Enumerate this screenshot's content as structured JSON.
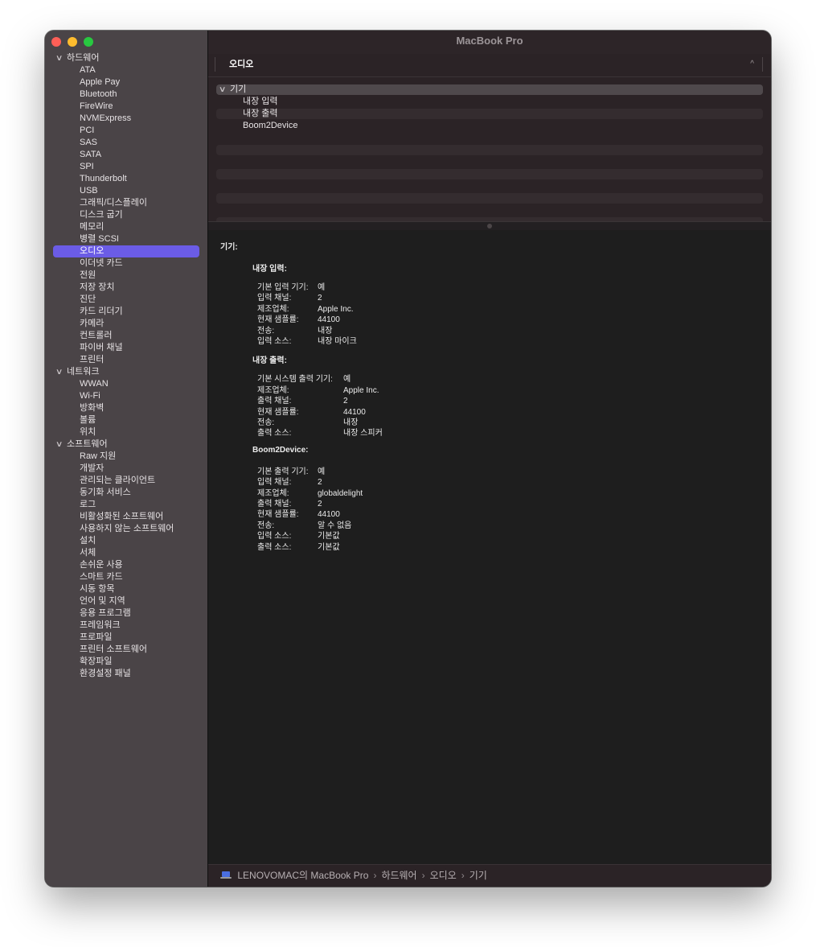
{
  "window": {
    "title": "MacBook Pro"
  },
  "sidebar": {
    "groups": [
      {
        "label": "하드웨어",
        "items": [
          "ATA",
          "Apple Pay",
          "Bluetooth",
          "FireWire",
          "NVMExpress",
          "PCI",
          "SAS",
          "SATA",
          "SPI",
          "Thunderbolt",
          "USB",
          "그래픽/디스플레이",
          "디스크 굽기",
          "메모리",
          "병렬 SCSI",
          "오디오",
          "이더넷 카드",
          "전원",
          "저장 장치",
          "진단",
          "카드 리더기",
          "카메라",
          "컨트롤러",
          "파이버 채널",
          "프린터"
        ]
      },
      {
        "label": "네트워크",
        "items": [
          "WWAN",
          "Wi-Fi",
          "방화벽",
          "볼륨",
          "위치"
        ]
      },
      {
        "label": "소프트웨어",
        "items": [
          "Raw 지원",
          "개발자",
          "관리되는 클라이언트",
          "동기화 서비스",
          "로그",
          "비활성화된 소프트웨어",
          "사용하지 않는 소프트웨어",
          "설치",
          "서체",
          "손쉬운 사용",
          "스마트 카드",
          "시동 항목",
          "언어 및 지역",
          "응용 프로그램",
          "프레임워크",
          "프로파일",
          "프린터 소프트웨어",
          "확장파일",
          "환경설정 패널"
        ]
      }
    ],
    "selected": "오디오"
  },
  "list": {
    "column_header": "오디오",
    "parent": "기기",
    "children": [
      "내장 입력",
      "내장 출력",
      "Boom2Device"
    ]
  },
  "detail": {
    "title": "기기:",
    "devices": [
      {
        "name": "내장 입력:",
        "props": [
          {
            "k": "기본 입력 기기:",
            "v": "예"
          },
          {
            "k": "입력 채널:",
            "v": "2"
          },
          {
            "k": "제조업체:",
            "v": "Apple Inc."
          },
          {
            "k": "현재 샘플률:",
            "v": "44100"
          },
          {
            "k": "전송:",
            "v": "내장"
          },
          {
            "k": "입력 소스:",
            "v": "내장 마이크"
          }
        ]
      },
      {
        "name": "내장 출력:",
        "props": [
          {
            "k": "기본 시스템 출력 기기:",
            "v": "예"
          },
          {
            "k": "제조업체:",
            "v": "Apple Inc."
          },
          {
            "k": "출력 채널:",
            "v": "2"
          },
          {
            "k": "현재 샘플률:",
            "v": "44100"
          },
          {
            "k": "전송:",
            "v": "내장"
          },
          {
            "k": "출력 소스:",
            "v": "내장 스피커"
          }
        ]
      },
      {
        "name": "Boom2Device:",
        "props": [
          {
            "k": "기본 출력 기기:",
            "v": "예"
          },
          {
            "k": "입력 채널:",
            "v": "2"
          },
          {
            "k": "제조업체:",
            "v": "globaldelight"
          },
          {
            "k": "출력 채널:",
            "v": "2"
          },
          {
            "k": "현재 샘플률:",
            "v": "44100"
          },
          {
            "k": "전송:",
            "v": "알 수 없음"
          },
          {
            "k": "입력 소스:",
            "v": "기본값"
          },
          {
            "k": "출력 소스:",
            "v": "기본값"
          }
        ]
      }
    ]
  },
  "breadcrumb": {
    "icon": "laptop-icon",
    "items": [
      "LENOVOMAC의 MacBook Pro",
      "하드웨어",
      "오디오",
      "기기"
    ],
    "separator": "›"
  }
}
